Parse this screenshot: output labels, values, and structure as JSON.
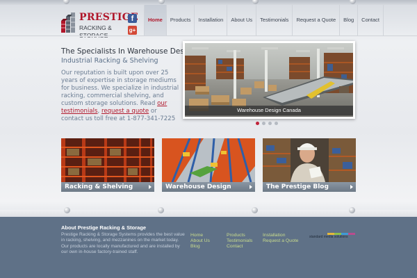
{
  "header": {
    "logo": {
      "name": "PRESTIGE",
      "tagline": "RACKING & STORAGE"
    },
    "social": {
      "facebook": "f",
      "google_plus": "g+"
    },
    "nav": [
      {
        "label": "Home",
        "active": true
      },
      {
        "label": "Products"
      },
      {
        "label": "Installation"
      },
      {
        "label": "About Us"
      },
      {
        "label": "Testimonials"
      },
      {
        "label": "Request a Quote"
      },
      {
        "label": "Blog"
      },
      {
        "label": "Contact"
      }
    ]
  },
  "hero": {
    "title": "The Specialists In Warehouse Design",
    "subtitle": "Industrial Racking & Shelving",
    "body_lead": "Our reputation is built upon over 25 years of expertise in storage mediums for business. We specialize in industrial racking, commercial shelving, and custom storage solutions. Read ",
    "link_testimonials": "our testimonials",
    "separator": ", ",
    "link_quote": "request a quote",
    "body_tail": " or contact us toll free at 1-877-341-7225"
  },
  "slider": {
    "caption": "Warehouse Design Canada",
    "slide_count": 4,
    "active_index": 0
  },
  "cards": [
    {
      "label": "Racking & Shelving"
    },
    {
      "label": "Warehouse Design"
    },
    {
      "label": "The Prestige Blog"
    }
  ],
  "footer": {
    "title": "About Prestige Racking & Storage",
    "text": "Prestige Racking & Storage Systems provides the best value in racking, shelving, and mezzanines on the market today. Our products are locally manufactured and are installed by our own in-house factory-trained staff.",
    "links_col1": [
      "Home",
      "About Us",
      "Blog"
    ],
    "links_col2": [
      "Products",
      "Testimonials",
      "Contact"
    ],
    "links_col3": [
      "Installation",
      "Request a Quote"
    ],
    "brand": "standard media solutions"
  },
  "colors": {
    "brand_red": "#b0172b",
    "footer_bg": "#5f7187",
    "footer_link": "#c9dc8c"
  }
}
